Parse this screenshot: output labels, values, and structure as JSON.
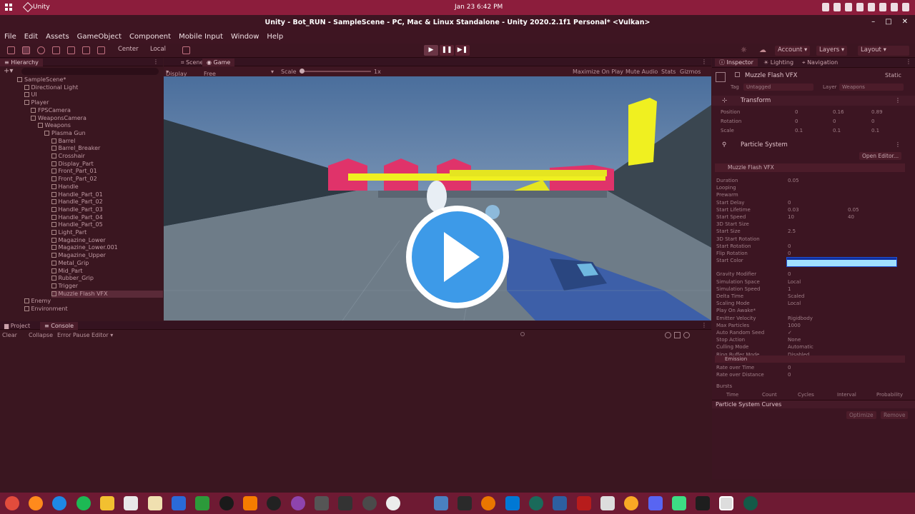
{
  "system_bar": {
    "app_name": "Unity",
    "clock": "Jan 23   6:42 PM"
  },
  "window": {
    "title": "Unity - Bot_RUN - SampleScene - PC, Mac & Linux Standalone - Unity 2020.2.1f1 Personal* <Vulkan>",
    "minimize": "–",
    "maximize": "□",
    "close": "✕"
  },
  "menu": [
    "File",
    "Edit",
    "Assets",
    "GameObject",
    "Component",
    "Mobile Input",
    "Window",
    "Help"
  ],
  "toolbar": {
    "center": "Center",
    "local": "Local",
    "account": "Account",
    "layers": "Layers",
    "layout": "Layout",
    "play": "▶",
    "pause": "❚❚",
    "step": "▶❚"
  },
  "hierarchy": {
    "tab": "Hierarchy",
    "items": [
      {
        "label": "SampleScene*",
        "depth": 0
      },
      {
        "label": "Directional Light",
        "depth": 1
      },
      {
        "label": "UI",
        "depth": 1
      },
      {
        "label": "Player",
        "depth": 1
      },
      {
        "label": "FPSCamera",
        "depth": 2
      },
      {
        "label": "WeaponsCamera",
        "depth": 2
      },
      {
        "label": "Weapons",
        "depth": 3
      },
      {
        "label": "Plasma Gun",
        "depth": 4
      },
      {
        "label": "Barrel",
        "depth": 5
      },
      {
        "label": "Barrel_Breaker",
        "depth": 5
      },
      {
        "label": "Crosshair",
        "depth": 5
      },
      {
        "label": "Display_Part",
        "depth": 5
      },
      {
        "label": "Front_Part_01",
        "depth": 5
      },
      {
        "label": "Front_Part_02",
        "depth": 5
      },
      {
        "label": "Handle",
        "depth": 5
      },
      {
        "label": "Handle_Part_01",
        "depth": 5
      },
      {
        "label": "Handle_Part_02",
        "depth": 5
      },
      {
        "label": "Handle_Part_03",
        "depth": 5
      },
      {
        "label": "Handle_Part_04",
        "depth": 5
      },
      {
        "label": "Handle_Part_05",
        "depth": 5
      },
      {
        "label": "Light_Part",
        "depth": 5
      },
      {
        "label": "Magazine_Lower",
        "depth": 5
      },
      {
        "label": "Magazine_Lower.001",
        "depth": 5
      },
      {
        "label": "Magazine_Upper",
        "depth": 5
      },
      {
        "label": "Metal_Grip",
        "depth": 5
      },
      {
        "label": "Mid_Part",
        "depth": 5
      },
      {
        "label": "Rubber_Grip",
        "depth": 5
      },
      {
        "label": "Trigger",
        "depth": 5
      },
      {
        "label": "Muzzle Flash VFX",
        "depth": 5
      },
      {
        "label": "Enemy",
        "depth": 1
      },
      {
        "label": "Environment",
        "depth": 1
      }
    ]
  },
  "game_view": {
    "tab_scene": "Scene",
    "tab_game": "Game",
    "display": "Display 1",
    "aspect": "Free Aspect",
    "scale_label": "Scale",
    "scale_value": "1x",
    "options": [
      "Maximize On Play",
      "Mute Audio",
      "Stats",
      "Gizmos"
    ]
  },
  "inspector": {
    "tabs": [
      "Inspector",
      "Lighting",
      "Navigation"
    ],
    "object_name": "Muzzle Flash VFX",
    "static": "Static",
    "tag_label": "Tag",
    "tag_value": "Untagged",
    "layer_label": "Layer",
    "layer_value": "Weapons",
    "transform": {
      "title": "Transform",
      "rows": [
        {
          "label": "Position",
          "x": "0",
          "y": "0.16",
          "z": "0.89"
        },
        {
          "label": "Rotation",
          "x": "0",
          "y": "0",
          "z": "0"
        },
        {
          "label": "Scale",
          "x": "0.1",
          "y": "0.1",
          "z": "0.1"
        }
      ]
    },
    "particle_system": {
      "title": "Particle System",
      "open_editor": "Open Editor...",
      "module_title": "Muzzle Flash VFX"
    },
    "particle_props": [
      {
        "label": "Duration",
        "value": "0.05"
      },
      {
        "label": "Looping",
        "value": ""
      },
      {
        "label": "Prewarm",
        "value": ""
      },
      {
        "label": "Start Delay",
        "value": "0"
      },
      {
        "label": "Start Lifetime",
        "value": "0.03",
        "value2": "0.05"
      },
      {
        "label": "Start Speed",
        "value": "10",
        "value2": "40"
      },
      {
        "label": "3D Start Size",
        "value": ""
      },
      {
        "label": "Start Size",
        "value": "2.5"
      },
      {
        "label": "3D Start Rotation",
        "value": ""
      },
      {
        "label": "Start Rotation",
        "value": "0"
      },
      {
        "label": "Flip Rotation",
        "value": "0"
      },
      {
        "label": "Start Color",
        "value": ""
      },
      {
        "label": "Gravity Modifier",
        "value": "0"
      },
      {
        "label": "Simulation Space",
        "value": "Local"
      },
      {
        "label": "Simulation Speed",
        "value": "1"
      },
      {
        "label": "Delta Time",
        "value": "Scaled"
      },
      {
        "label": "Scaling Mode",
        "value": "Local"
      },
      {
        "label": "Play On Awake*",
        "value": ""
      },
      {
        "label": "Emitter Velocity",
        "value": "Rigidbody"
      },
      {
        "label": "Max Particles",
        "value": "1000"
      },
      {
        "label": "Auto Random Seed",
        "value": "✓"
      },
      {
        "label": "Stop Action",
        "value": "None"
      },
      {
        "label": "Culling Mode",
        "value": "Automatic"
      },
      {
        "label": "Ring Buffer Mode",
        "value": "Disabled"
      }
    ],
    "emission": {
      "title": "Emission",
      "rows": [
        {
          "label": "Rate over Time",
          "value": "0"
        },
        {
          "label": "Rate over Distance",
          "value": "0"
        }
      ],
      "bursts_label": "Bursts",
      "burst_columns": [
        "Time",
        "Count",
        "Cycles",
        "Interval",
        "Probability"
      ]
    },
    "curves_title": "Particle System Curves",
    "optimize": "Optimize",
    "remove": "Remove"
  },
  "console": {
    "tab_project": "Project",
    "tab_console": "Console",
    "clear": "Clear",
    "collapse": "Collapse",
    "error_pause": "Error Pause",
    "editor": "Editor ▾"
  },
  "colors": {
    "accent": "#8c1d3c",
    "panel": "#3a1620",
    "play_overlay": "#3d9ae8"
  }
}
